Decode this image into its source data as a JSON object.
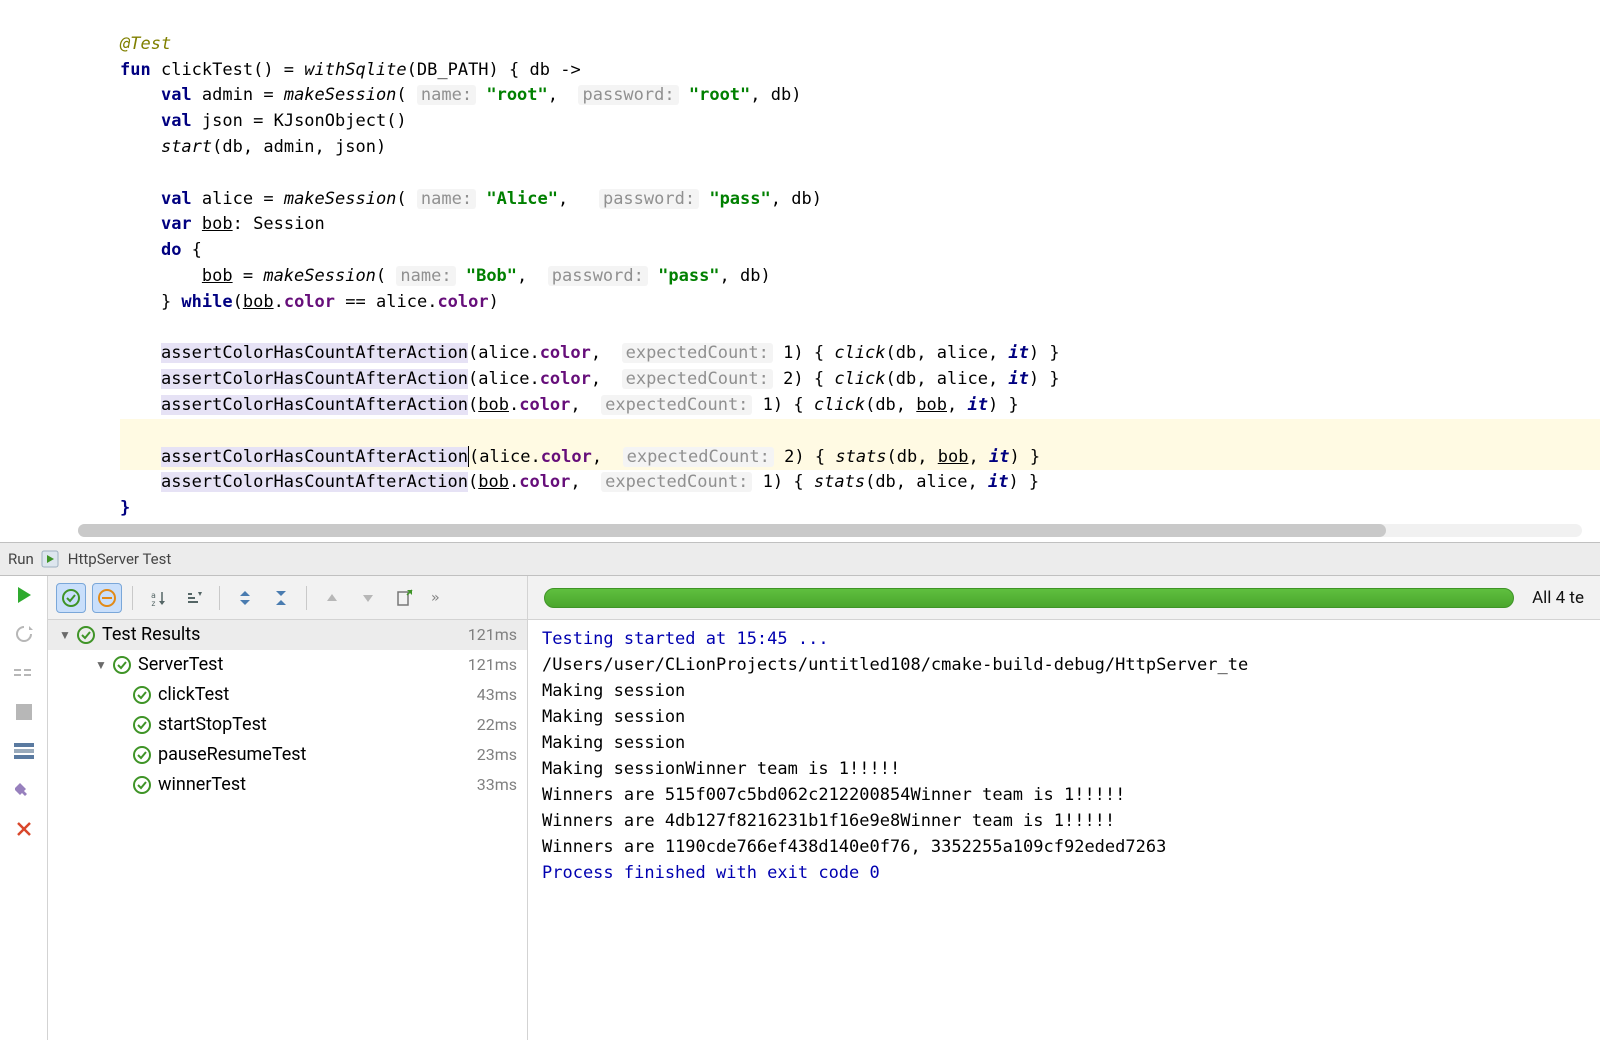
{
  "editor": {
    "annotation": "@Test",
    "kw_fun": "fun",
    "fn_name": "clickTest",
    "fn_withSqlite": "withSqlite",
    "db_path": "DB_PATH",
    "lambda_param": "db",
    "kw_val": "val",
    "kw_var": "var",
    "kw_do": "do",
    "kw_while": "while",
    "admin": "admin",
    "json": "json",
    "alice": "alice",
    "bob": "bob",
    "db": "db",
    "it": "it",
    "fn_makeSession": "makeSession",
    "type_KJsonObject": "KJsonObject",
    "fn_start": "start",
    "type_Session": "Session",
    "hint_name": "name:",
    "hint_password": "password:",
    "hint_expectedCount": "expectedCount:",
    "str_root": "\"root\"",
    "str_Alice": "\"Alice\"",
    "str_Bob": "\"Bob\"",
    "str_pass": "\"pass\"",
    "field_color": "color",
    "fn_assert": "assertColorHasCountAfterAction",
    "fn_click": "click",
    "fn_stats": "stats",
    "num_1": "1",
    "num_2": "2",
    "eq": "=="
  },
  "toolwin": {
    "run_label": "Run",
    "title": "HttpServer Test"
  },
  "toolbar": {
    "more": "»"
  },
  "tree": {
    "root": "Test Results",
    "root_time": "121ms",
    "suite": "ServerTest",
    "suite_time": "121ms",
    "tests": [
      {
        "name": "clickTest",
        "time": "43ms"
      },
      {
        "name": "startStopTest",
        "time": "22ms"
      },
      {
        "name": "pauseResumeTest",
        "time": "23ms"
      },
      {
        "name": "winnerTest",
        "time": "33ms"
      }
    ]
  },
  "summary": "All 4 te",
  "console": {
    "l1": "Testing started at 15:45 ...",
    "l2": "/Users/user/CLionProjects/untitled108/cmake-build-debug/HttpServer_te",
    "l3": "Making session",
    "l4": "Making session",
    "l5": "Making session",
    "l6": "Making sessionWinner team is 1!!!!!",
    "l7": "Winners are 515f007c5bd062c212200854Winner team is 1!!!!!",
    "l8": "Winners are 4db127f8216231b1f16e9e8Winner team is 1!!!!!",
    "l9": "Winners are 1190cde766ef438d140e0f76, 3352255a109cf92eded7263",
    "l10": "Process finished with exit code 0"
  }
}
